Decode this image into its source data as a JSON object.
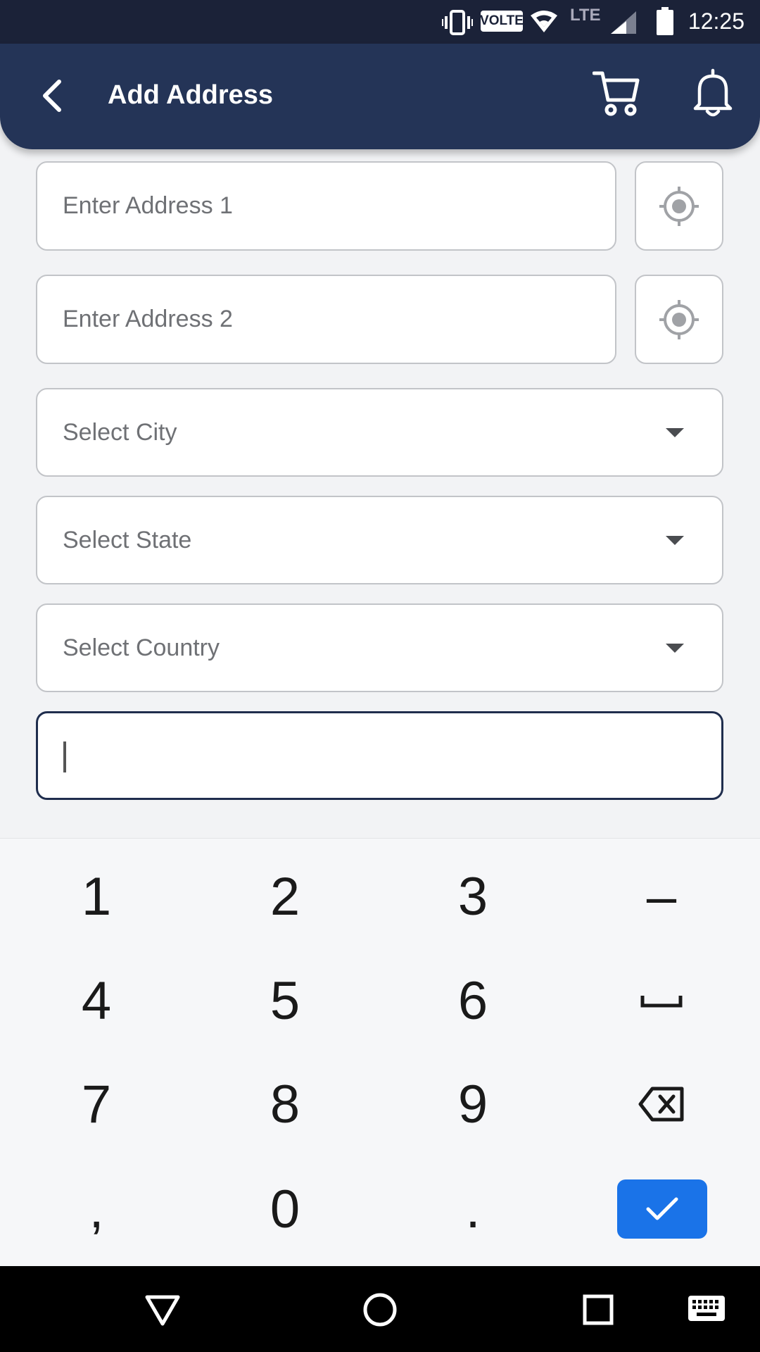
{
  "status_bar": {
    "time": "12:25",
    "volte_label": "VOLTE",
    "lte_label": "LTE",
    "icons": [
      "vibrate-icon",
      "volte-icon",
      "wifi-icon",
      "lte-icon",
      "signal-icon",
      "battery-icon"
    ]
  },
  "header": {
    "title": "Add Address",
    "back_icon": "back-arrow-icon",
    "cart_icon": "cart-icon",
    "bell_icon": "bell-icon"
  },
  "form": {
    "address1_placeholder": "Enter Address 1",
    "address2_placeholder": "Enter Address 2",
    "city_placeholder": "Select City",
    "state_placeholder": "Select State",
    "country_placeholder": "Select Country",
    "pincode_value": ""
  },
  "keyboard": {
    "rows": [
      [
        "1",
        "2",
        "3",
        "–"
      ],
      [
        "4",
        "5",
        "6",
        "space"
      ],
      [
        "7",
        "8",
        "9",
        "backspace"
      ],
      [
        ",",
        "0",
        ".",
        "enter"
      ]
    ],
    "k1": "1",
    "k2": "2",
    "k3": "3",
    "kdash": "–",
    "k4": "4",
    "k5": "5",
    "k6": "6",
    "k7": "7",
    "k8": "8",
    "k9": "9",
    "kcomma": ",",
    "k0": "0",
    "kdot": ".",
    "accent": "#1a73e8"
  },
  "colors": {
    "header_bg": "#243457",
    "status_bg": "#1b2238",
    "active_border": "#1f2d4d"
  }
}
